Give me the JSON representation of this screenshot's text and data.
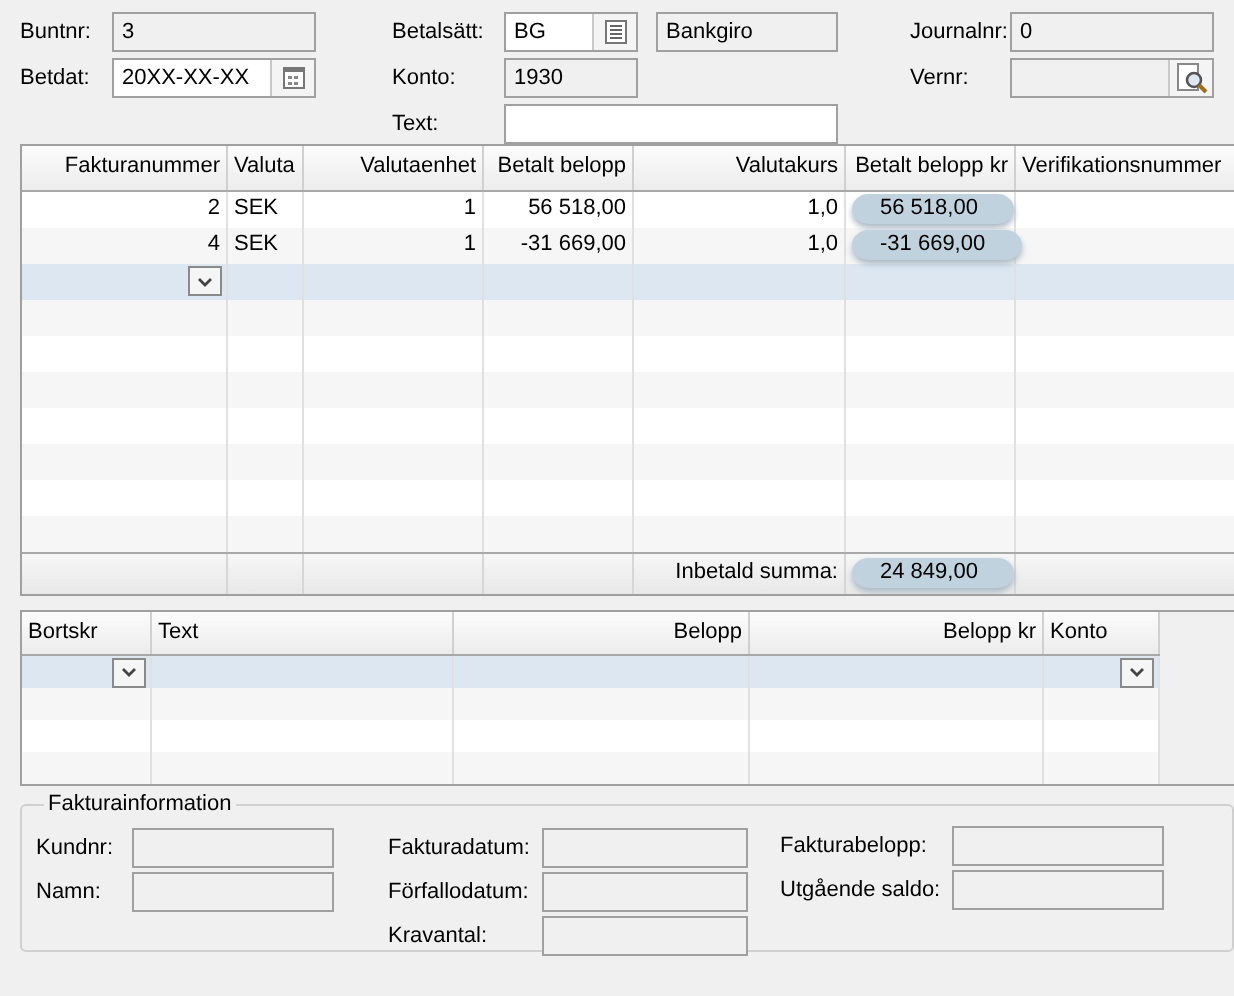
{
  "header_form": {
    "buntnr": {
      "label": "Buntnr:",
      "value": "3"
    },
    "betdat": {
      "label": "Betdat:",
      "value": "20XX-XX-XX"
    },
    "betalsatt": {
      "label": "Betalsätt:",
      "value": "BG",
      "name": "Bankgiro"
    },
    "konto": {
      "label": "Konto:",
      "value": "1930"
    },
    "text": {
      "label": "Text:"
    },
    "journalnr": {
      "label": "Journalnr:",
      "value": "0"
    },
    "vernr": {
      "label": "Vernr:"
    }
  },
  "payments_table": {
    "columns": [
      "Fakturanummer",
      "Valuta",
      "Valutaenhet",
      "Betalt belopp",
      "Valutakurs",
      "Betalt belopp kr",
      "Verifikationsnummer"
    ],
    "rows": [
      {
        "selected": false,
        "cells": [
          "2",
          "SEK",
          "1",
          "56 518,00",
          "1,0",
          "56 518,00",
          ""
        ],
        "highlighted": true
      },
      {
        "selected": false,
        "cells": [
          "4",
          "SEK",
          "1",
          "-31 669,00",
          "1,0",
          "-31 669,00",
          ""
        ],
        "highlighted": true
      }
    ],
    "new_row": {
      "selected": true
    },
    "total": {
      "label": "Inbetald summa:",
      "value": "24 849,00",
      "highlighted": true
    }
  },
  "writeoff_table": {
    "columns": [
      "Bortskr",
      "Text",
      "Belopp",
      "Belopp kr",
      "Konto"
    ],
    "new_row": {
      "selected": true
    }
  },
  "invoice_info": {
    "title": "Fakturainformation",
    "customer_fields": [
      "Kundnr:",
      "Namn:"
    ],
    "date_fields": [
      "Fakturadatum:",
      "Förfallodatum:",
      "Kravantal:"
    ],
    "amount_fields": [
      "Fakturabelopp:",
      "Utgående saldo:"
    ]
  }
}
